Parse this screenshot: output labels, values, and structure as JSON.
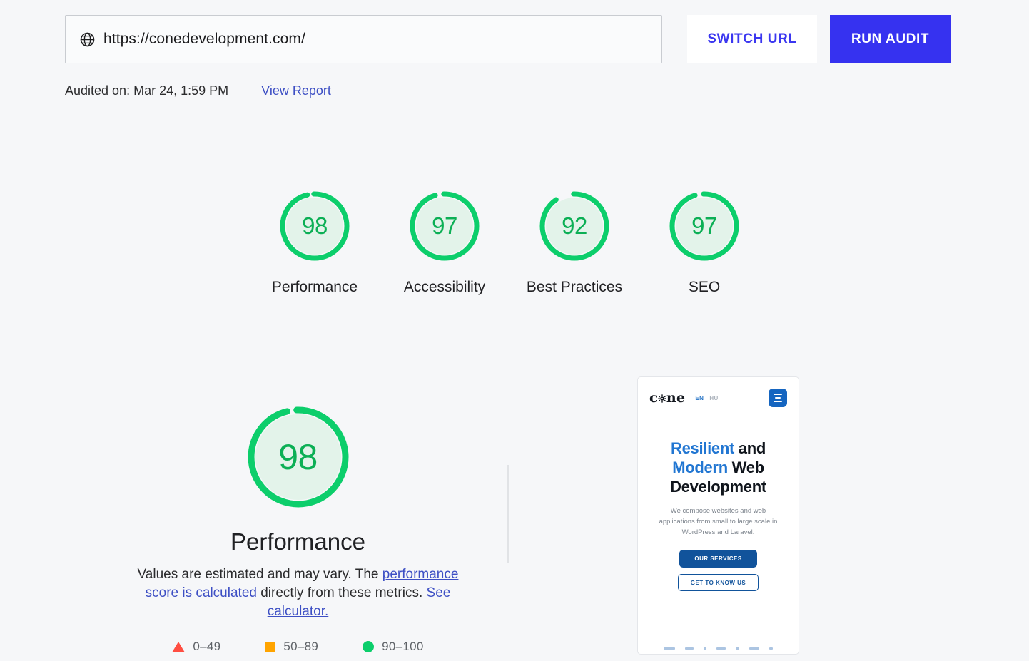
{
  "page": {
    "background_color": "#f6f7f9"
  },
  "toolbar": {
    "url_value": "https://conedevelopment.com/",
    "url_placeholder": "Enter a web page URL",
    "globe_icon": "globe-icon",
    "switch_url_label": "SWITCH URL",
    "run_audit_label": "RUN AUDIT",
    "accent_color": "#3632f0"
  },
  "audit_meta": {
    "audited_on": "Audited on: Mar 24, 1:59 PM",
    "view_report_label": "View Report",
    "link_color": "#3d4fc4"
  },
  "scores": {
    "pass_color": "#0cce6b",
    "pass_fill": "#e3f3ea",
    "items": [
      {
        "label": "Performance",
        "value": 98,
        "name": "score-gauge-performance"
      },
      {
        "label": "Accessibility",
        "value": 97,
        "name": "score-gauge-accessibility"
      },
      {
        "label": "Best Practices",
        "value": 92,
        "name": "score-gauge-best-practices"
      },
      {
        "label": "SEO",
        "value": 97,
        "name": "score-gauge-seo"
      }
    ]
  },
  "detail": {
    "score": 98,
    "title": "Performance",
    "description_part1": "Values are estimated and may vary. The ",
    "link1": "performance score is calculated",
    "description_part2": " directly from these metrics. ",
    "link2": "See calculator.",
    "legend": [
      {
        "shape": "triangle",
        "color": "#ff4e42",
        "range": "0–49"
      },
      {
        "shape": "square",
        "color": "#ffa400",
        "range": "50–89"
      },
      {
        "shape": "circle",
        "color": "#0cce6b",
        "range": "90–100"
      }
    ]
  },
  "preview": {
    "logo_text_before": "c",
    "logo_text_after": "ne",
    "lang_active": "EN",
    "lang_inactive": "HU",
    "menu_icon": "hamburger-menu-icon",
    "hero_word1": "Resilient",
    "hero_word2": " and",
    "hero_word3": "Modern",
    "hero_word4": " Web",
    "hero_word5": "Development",
    "hero_sub": "We compose websites and web applications from small to large scale in WordPress and Laravel.",
    "cta_primary": "OUR SERVICES",
    "cta_secondary": "GET TO KNOW US",
    "brand_blue": "#2176d2",
    "button_blue": "#11539b"
  }
}
